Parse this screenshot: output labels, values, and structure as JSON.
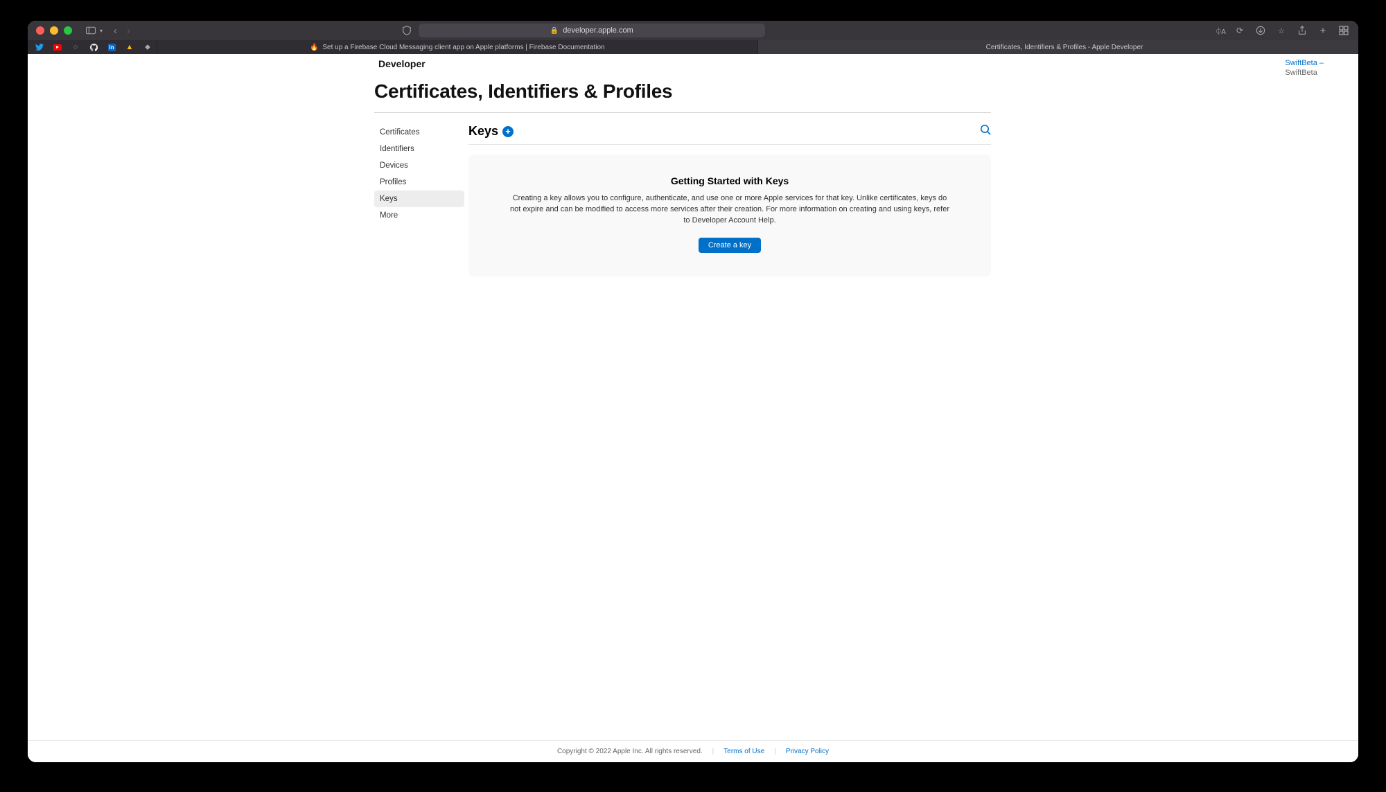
{
  "browser": {
    "url_host": "developer.apple.com",
    "tabs": [
      {
        "label": "Set up a Firebase Cloud Messaging client app on Apple platforms  |  Firebase Documentation",
        "favicon": "🔥"
      },
      {
        "label": "Certificates, Identifiers & Profiles - Apple Developer",
        "favicon": "apple"
      }
    ]
  },
  "header": {
    "brand": "Developer"
  },
  "account": {
    "line1": "SwiftBeta –",
    "line2": "SwiftBeta"
  },
  "page": {
    "title": "Certificates, Identifiers & Profiles"
  },
  "sidebar": {
    "items": [
      {
        "label": "Certificates"
      },
      {
        "label": "Identifiers"
      },
      {
        "label": "Devices"
      },
      {
        "label": "Profiles"
      },
      {
        "label": "Keys"
      },
      {
        "label": "More"
      }
    ],
    "active_index": 4
  },
  "main": {
    "heading": "Keys",
    "card": {
      "title": "Getting Started with Keys",
      "body": "Creating a key allows you to configure, authenticate, and use one or more Apple services for that key. Unlike certificates, keys do not expire and can be modified to access more services after their creation. For more information on creating and using keys, refer to Developer Account Help.",
      "button": "Create a key"
    }
  },
  "footer": {
    "copyright": "Copyright © 2022 Apple Inc. All rights reserved.",
    "links": [
      {
        "label": "Terms of Use"
      },
      {
        "label": "Privacy Policy"
      }
    ]
  }
}
